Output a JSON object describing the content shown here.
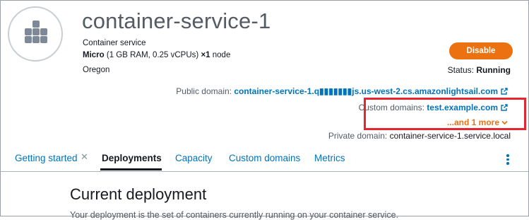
{
  "service": {
    "name": "container-service-1",
    "type": "Container service",
    "power": "Micro",
    "specs": " (1 GB RAM, 0.25 vCPUs) ",
    "scale": "×1",
    "scale_unit": " node",
    "region": "Oregon"
  },
  "actions": {
    "disable_label": "Disable"
  },
  "status": {
    "label": "Status: ",
    "value": "Running"
  },
  "domains": {
    "public_label": "Public domain: ",
    "public_value": "container-service-1.q▮▮▮▮▮▮▮js.us-west-2.cs.amazonlightsail.com",
    "custom_label": "Custom domains: ",
    "custom_value": "test.example.com",
    "more_label": "...and 1 more",
    "private_label": "Private domain: ",
    "private_value": "container-service-1.service.local"
  },
  "tabs": [
    {
      "label": "Getting started",
      "active": false
    },
    {
      "label": "Deployments",
      "active": true
    },
    {
      "label": "Capacity",
      "active": false
    },
    {
      "label": "Custom domains",
      "active": false
    },
    {
      "label": "Metrics",
      "active": false
    }
  ],
  "content": {
    "title": "Current deployment",
    "description": "Your deployment is the set of containers currently running on your container service."
  },
  "colors": {
    "accent": "#ec7211",
    "link": "#0073bb",
    "highlight": "#e3262f"
  },
  "icons": [
    "container-service-icon",
    "external-link-icon",
    "chevron-down-icon",
    "close-icon",
    "kebab-menu-icon"
  ]
}
